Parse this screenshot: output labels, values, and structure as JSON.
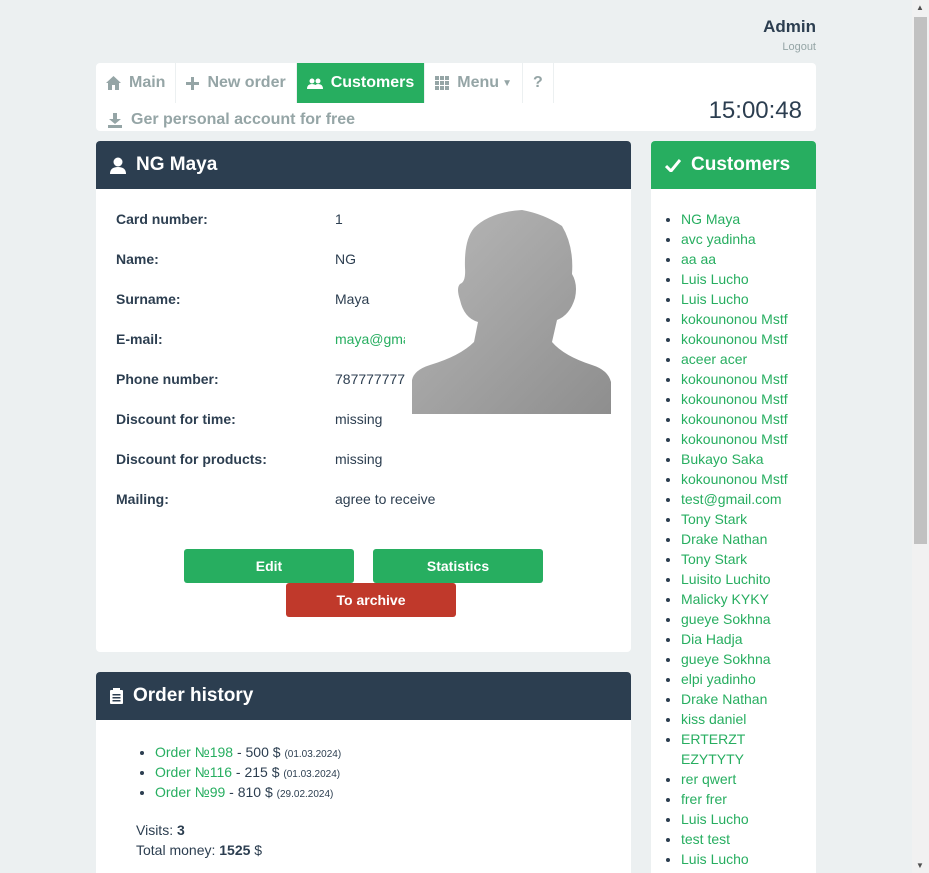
{
  "header": {
    "user": "Admin",
    "logout": "Logout"
  },
  "nav": {
    "items": [
      {
        "label": "Main",
        "icon": "home-icon"
      },
      {
        "label": "New order",
        "icon": "plus-icon"
      },
      {
        "label": "Customers",
        "icon": "users-icon"
      },
      {
        "label": "Menu",
        "icon": "grid-icon"
      },
      {
        "label": "?"
      }
    ],
    "active": "Customers",
    "promo": "Ger personal account for free",
    "clock": "15:00:48"
  },
  "profile": {
    "title": "NG Maya",
    "fields": [
      {
        "label": "Card number:",
        "value": "1"
      },
      {
        "label": "Name:",
        "value": "NG"
      },
      {
        "label": "Surname:",
        "value": "Maya"
      },
      {
        "label": "E-mail:",
        "value": "maya@gmail.com"
      },
      {
        "label": "Phone number:",
        "value": "787777777"
      },
      {
        "label": "Discount for time:",
        "value": "missing"
      },
      {
        "label": "Discount for products:",
        "value": "missing"
      },
      {
        "label": "Mailing:",
        "value": "agree to receive"
      }
    ],
    "buttons": {
      "edit": "Edit",
      "statistics": "Statistics",
      "archive": "To archive"
    }
  },
  "history": {
    "title": "Order history",
    "orders": [
      {
        "link": "Order №198",
        "amount": " - 500 $ ",
        "date": "(01.03.2024)"
      },
      {
        "link": "Order №116",
        "amount": " - 215 $ ",
        "date": "(01.03.2024)"
      },
      {
        "link": "Order №99",
        "amount": " - 810 $ ",
        "date": "(29.02.2024)"
      }
    ],
    "visits_label": "Visits: ",
    "visits": "3",
    "total_label": "Total money: ",
    "total": "1525",
    "currency": " $"
  },
  "customers": {
    "title": "Customers",
    "list": [
      "NG Maya",
      "avc yadinha",
      "aa aa",
      "Luis Lucho",
      "Luis Lucho",
      "kokounonou Mstf",
      "kokounonou Mstf",
      "aceer acer",
      "kokounonou Mstf",
      "kokounonou Mstf",
      "kokounonou Mstf",
      "kokounonou Mstf",
      "Bukayo Saka",
      "kokounonou Mstf",
      "test@gmail.com",
      "Tony Stark",
      "Drake Nathan",
      "Tony Stark",
      "Luisito Luchito",
      "Malicky KYKY",
      "gueye Sokhna",
      "Dia Hadja",
      "gueye Sokhna",
      "elpi yadinho",
      "Drake Nathan",
      "kiss daniel",
      "ERTERZT EZYTYTY",
      "rer qwert",
      "frer frer",
      "Luis Lucho",
      "test test",
      "Luis Lucho"
    ]
  },
  "colors": {
    "accent": "#27ae60",
    "dark": "#2c3e50",
    "danger": "#c0392b",
    "muted": "#95a5a6"
  }
}
